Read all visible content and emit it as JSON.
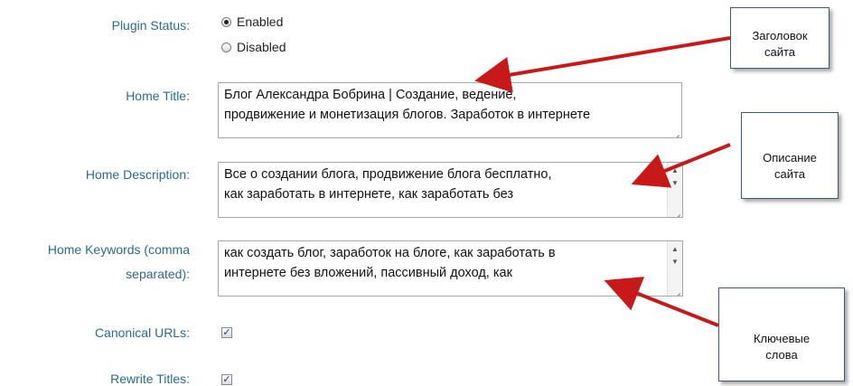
{
  "fields": {
    "plugin_status": {
      "label": "Plugin Status:",
      "options": [
        {
          "label": "Enabled",
          "checked": true
        },
        {
          "label": "Disabled",
          "checked": false
        }
      ]
    },
    "home_title": {
      "label": "Home Title:",
      "lines": [
        "Блог Александра Бобрина | Создание, ведение,",
        "продвижение и монетизация блогов. Заработок в интернете"
      ]
    },
    "home_description": {
      "label": "Home Description:",
      "lines": [
        "Все о создании блога, продвижение блога бесплатно,",
        "как заработать в интернете, как заработать без"
      ]
    },
    "home_keywords": {
      "label_line1": "Home Keywords (comma",
      "label_line2": "separated):",
      "lines": [
        "как создать блог, заработок на блоге, как заработать в",
        "интернете без вложений, пассивный доход, как"
      ]
    },
    "canonical_urls": {
      "label": "Canonical URLs:",
      "checked": true
    },
    "rewrite_titles": {
      "label": "Rewrite Titles:",
      "checked": true
    }
  },
  "callouts": {
    "title": {
      "line1": "Заголовок",
      "line2": "сайта"
    },
    "description": {
      "line1": "Описание",
      "line2": "сайта"
    },
    "keywords": {
      "line1": "Ключевые",
      "line2": "слова"
    }
  },
  "colors": {
    "label": "#2b6b8e",
    "arrow": "#c8191a",
    "callout_border": "#3b5a7a"
  },
  "icons": {
    "checkmark": "✓",
    "scroll_up": "▲",
    "scroll_down": "▼"
  }
}
